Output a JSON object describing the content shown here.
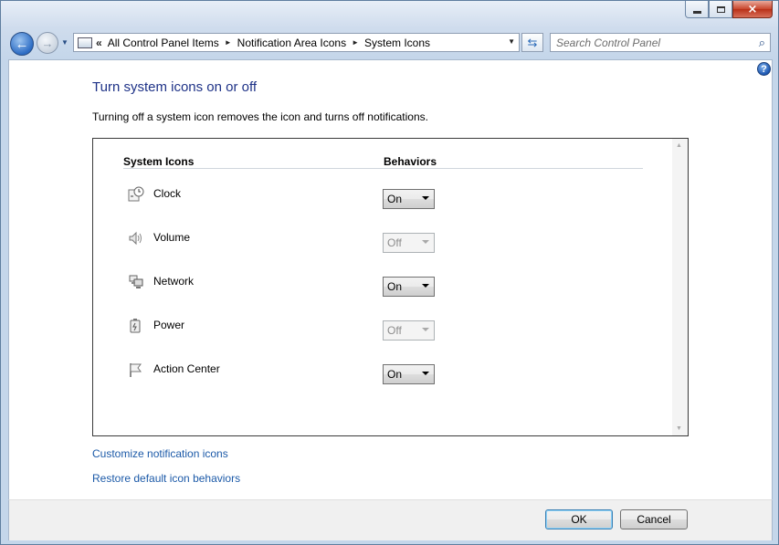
{
  "window": {
    "caption": {
      "minimize": "minimize",
      "maximize": "maximize",
      "close": "×"
    }
  },
  "nav": {
    "back_glyph": "←",
    "forward_glyph": "→",
    "breadcrumb": [
      "All Control Panel Items",
      "Notification Area Icons",
      "System Icons"
    ],
    "overflow": "«",
    "separator": "►",
    "dropdown_glyph": "▼",
    "refresh_glyph": "⇆",
    "search_placeholder": "Search Control Panel",
    "search_glyph": "⌕"
  },
  "page": {
    "help_glyph": "?",
    "title": "Turn system icons on or off",
    "description": "Turning off a system icon removes the icon and turns off notifications.",
    "columns": {
      "icons": "System Icons",
      "behaviors": "Behaviors"
    },
    "items": [
      {
        "label": "Clock",
        "icon": "clock-icon",
        "value": "On",
        "enabled": true
      },
      {
        "label": "Volume",
        "icon": "volume-icon",
        "value": "Off",
        "enabled": false
      },
      {
        "label": "Network",
        "icon": "network-icon",
        "value": "On",
        "enabled": true
      },
      {
        "label": "Power",
        "icon": "power-icon",
        "value": "Off",
        "enabled": false
      },
      {
        "label": "Action Center",
        "icon": "action-center-flag-icon",
        "value": "On",
        "enabled": true
      }
    ],
    "links": {
      "customize": "Customize notification icons",
      "restore": "Restore default icon behaviors"
    }
  },
  "footer": {
    "ok": "OK",
    "cancel": "Cancel"
  },
  "colors": {
    "title": "#1e3287",
    "link": "#1c5aa8",
    "accent": "#3c7fb1"
  }
}
